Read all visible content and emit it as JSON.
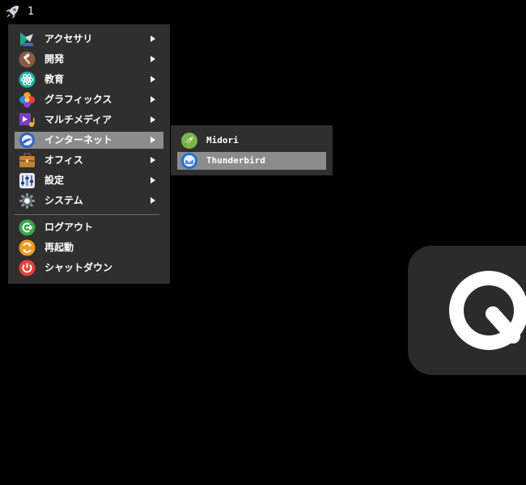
{
  "topbar": {
    "launcher_icon": "rocket-icon",
    "workspace_number": "1"
  },
  "menu": {
    "items": [
      {
        "label": "アクセサリ",
        "icon": "accessories-icon",
        "has_submenu": true
      },
      {
        "label": "開発",
        "icon": "development-hammer-icon",
        "has_submenu": true
      },
      {
        "label": "教育",
        "icon": "education-atom-icon",
        "has_submenu": true
      },
      {
        "label": "グラフィックス",
        "icon": "graphics-flower-icon",
        "has_submenu": true
      },
      {
        "label": "マルチメディア",
        "icon": "multimedia-icon",
        "has_submenu": true
      },
      {
        "label": "インターネット",
        "icon": "internet-globe-icon",
        "has_submenu": true,
        "active": true
      },
      {
        "label": "オフィス",
        "icon": "office-briefcase-icon",
        "has_submenu": true
      },
      {
        "label": "設定",
        "icon": "settings-icon",
        "has_submenu": true
      },
      {
        "label": "システム",
        "icon": "system-gear-icon",
        "has_submenu": true
      }
    ],
    "actions": [
      {
        "label": "ログアウト",
        "icon": "logout-icon"
      },
      {
        "label": "再起動",
        "icon": "restart-icon"
      },
      {
        "label": "シャットダウン",
        "icon": "shutdown-icon"
      }
    ]
  },
  "submenu": {
    "items": [
      {
        "label": "Midori",
        "icon": "midori-browser-icon"
      },
      {
        "label": "Thunderbird",
        "icon": "thunderbird-mail-icon",
        "active": true
      }
    ]
  },
  "dock_widget": {
    "icon": "search-q-icon"
  },
  "colors": {
    "background": "#000000",
    "menu_bg": "#2f2f2f",
    "highlight": "#8c8c8c",
    "text": "#ffffff",
    "separator": "#6a6a6a",
    "dock_bg": "#2b2b2b"
  }
}
